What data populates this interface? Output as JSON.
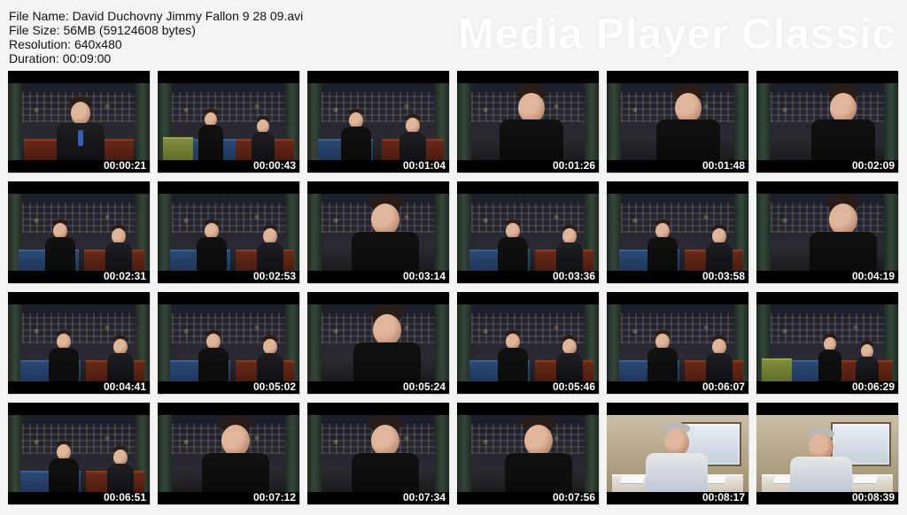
{
  "meta": {
    "file_name_label": "File Name:",
    "file_name": "David Duchovny Jimmy Fallon 9 28 09.avi",
    "file_size_label": "File Size:",
    "file_size": "56MB (59124608 bytes)",
    "resolution_label": "Resolution:",
    "resolution": "640x480",
    "duration_label": "Duration:",
    "duration": "00:09:00"
  },
  "brand": {
    "text": "Media Player Classic"
  },
  "thumbnails": [
    {
      "timestamp": "00:00:21"
    },
    {
      "timestamp": "00:00:43"
    },
    {
      "timestamp": "00:01:04"
    },
    {
      "timestamp": "00:01:26"
    },
    {
      "timestamp": "00:01:48"
    },
    {
      "timestamp": "00:02:09"
    },
    {
      "timestamp": "00:02:31"
    },
    {
      "timestamp": "00:02:53"
    },
    {
      "timestamp": "00:03:14"
    },
    {
      "timestamp": "00:03:36"
    },
    {
      "timestamp": "00:03:58"
    },
    {
      "timestamp": "00:04:19"
    },
    {
      "timestamp": "00:04:41"
    },
    {
      "timestamp": "00:05:02"
    },
    {
      "timestamp": "00:05:24"
    },
    {
      "timestamp": "00:05:46"
    },
    {
      "timestamp": "00:06:07"
    },
    {
      "timestamp": "00:06:29"
    },
    {
      "timestamp": "00:06:51"
    },
    {
      "timestamp": "00:07:12"
    },
    {
      "timestamp": "00:07:34"
    },
    {
      "timestamp": "00:07:56"
    },
    {
      "timestamp": "00:08:17"
    },
    {
      "timestamp": "00:08:39"
    }
  ]
}
